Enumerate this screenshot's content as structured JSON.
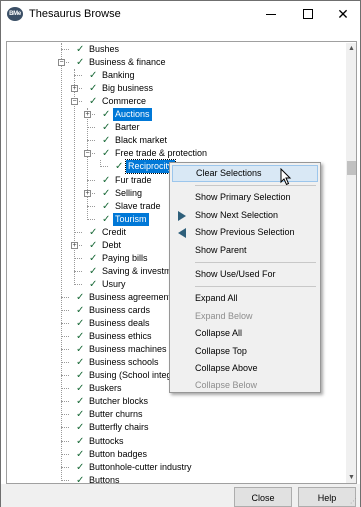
{
  "window": {
    "app_icon_text": "BMe",
    "title": "Thesaurus Browse",
    "minimize_glyph": "—",
    "maximize_glyph": "☐",
    "close_glyph": "✕"
  },
  "tree": {
    "items": [
      {
        "label": "Bushes",
        "level": 1,
        "checked": true,
        "expander": "",
        "selected": false
      },
      {
        "label": "Business & finance",
        "level": 1,
        "checked": true,
        "expander": "-",
        "selected": false
      },
      {
        "label": "Banking",
        "level": 2,
        "checked": true,
        "expander": "",
        "selected": false
      },
      {
        "label": "Big business",
        "level": 2,
        "checked": true,
        "expander": "+",
        "selected": false
      },
      {
        "label": "Commerce",
        "level": 2,
        "checked": true,
        "expander": "-",
        "selected": false
      },
      {
        "label": "Auctions",
        "level": 3,
        "checked": true,
        "expander": "+",
        "selected": true
      },
      {
        "label": "Barter",
        "level": 3,
        "checked": true,
        "expander": "",
        "selected": false
      },
      {
        "label": "Black market",
        "level": 3,
        "checked": true,
        "expander": "",
        "selected": false
      },
      {
        "label": "Free trade & protection",
        "level": 3,
        "checked": true,
        "expander": "-",
        "selected": false
      },
      {
        "label": "Reciprocity",
        "level": 4,
        "checked": true,
        "expander": "",
        "selected": true
      },
      {
        "label": "Fur trade",
        "level": 3,
        "checked": true,
        "expander": "",
        "selected": false
      },
      {
        "label": "Selling",
        "level": 3,
        "checked": true,
        "expander": "+",
        "selected": false
      },
      {
        "label": "Slave trade",
        "level": 3,
        "checked": true,
        "expander": "",
        "selected": false
      },
      {
        "label": "Tourism",
        "level": 3,
        "checked": true,
        "expander": "",
        "selected": true
      },
      {
        "label": "Credit",
        "level": 2,
        "checked": true,
        "expander": "",
        "selected": false
      },
      {
        "label": "Debt",
        "level": 2,
        "checked": true,
        "expander": "+",
        "selected": false
      },
      {
        "label": "Paying bills",
        "level": 2,
        "checked": true,
        "expander": "",
        "selected": false
      },
      {
        "label": "Saving & investme",
        "level": 2,
        "checked": true,
        "expander": "",
        "selected": false
      },
      {
        "label": "Usury",
        "level": 2,
        "checked": true,
        "expander": "",
        "selected": false
      },
      {
        "label": "Business agreements",
        "level": 1,
        "checked": true,
        "expander": "",
        "selected": false
      },
      {
        "label": "Business cards",
        "level": 1,
        "checked": true,
        "expander": "",
        "selected": false
      },
      {
        "label": "Business deals",
        "level": 1,
        "checked": true,
        "expander": "",
        "selected": false
      },
      {
        "label": "Business ethics",
        "level": 1,
        "checked": true,
        "expander": "",
        "selected": false
      },
      {
        "label": "Business machines",
        "level": 1,
        "checked": true,
        "expander": "",
        "selected": false
      },
      {
        "label": "Business schools",
        "level": 1,
        "checked": true,
        "expander": "",
        "selected": false
      },
      {
        "label": "Busing (School integra",
        "level": 1,
        "checked": true,
        "expander": "",
        "selected": false
      },
      {
        "label": "Buskers",
        "level": 1,
        "checked": true,
        "expander": "",
        "selected": false
      },
      {
        "label": "Butcher blocks",
        "level": 1,
        "checked": true,
        "expander": "",
        "selected": false
      },
      {
        "label": "Butter churns",
        "level": 1,
        "checked": true,
        "expander": "",
        "selected": false
      },
      {
        "label": "Butterfly chairs",
        "level": 1,
        "checked": true,
        "expander": "",
        "selected": false
      },
      {
        "label": "Buttocks",
        "level": 1,
        "checked": true,
        "expander": "",
        "selected": false
      },
      {
        "label": "Button badges",
        "level": 1,
        "checked": true,
        "expander": "",
        "selected": false
      },
      {
        "label": "Buttonhole-cutter industry",
        "level": 1,
        "checked": true,
        "expander": "",
        "selected": false
      },
      {
        "label": "Buttons",
        "level": 1,
        "checked": true,
        "expander": "",
        "selected": false
      }
    ]
  },
  "context_menu": {
    "items": [
      {
        "label": "Clear Selections",
        "enabled": true,
        "hover": true,
        "arrow": ""
      },
      {
        "separator": true
      },
      {
        "label": "Show Primary Selection",
        "enabled": true,
        "hover": false,
        "arrow": ""
      },
      {
        "label": "Show Next Selection",
        "enabled": true,
        "hover": false,
        "arrow": "right"
      },
      {
        "label": "Show Previous Selection",
        "enabled": true,
        "hover": false,
        "arrow": "left"
      },
      {
        "label": "Show Parent",
        "enabled": true,
        "hover": false,
        "arrow": ""
      },
      {
        "separator": true
      },
      {
        "label": "Show Use/Used For",
        "enabled": true,
        "hover": false,
        "arrow": ""
      },
      {
        "separator": true
      },
      {
        "label": "Expand All",
        "enabled": true,
        "hover": false,
        "arrow": ""
      },
      {
        "label": "Expand Below",
        "enabled": false,
        "hover": false,
        "arrow": ""
      },
      {
        "label": "Collapse All",
        "enabled": true,
        "hover": false,
        "arrow": ""
      },
      {
        "label": "Collapse Top",
        "enabled": true,
        "hover": false,
        "arrow": ""
      },
      {
        "label": "Collapse Above",
        "enabled": true,
        "hover": false,
        "arrow": ""
      },
      {
        "label": "Collapse Below",
        "enabled": false,
        "hover": false,
        "arrow": ""
      }
    ]
  },
  "footer": {
    "close_label": "Close",
    "help_label": "Help"
  },
  "colors": {
    "selection": "#0078d7",
    "checkmark": "#1c6b3a",
    "menu_hover": "#d9e8f5",
    "arrow": "#2e5f7a"
  },
  "icons": {
    "check": "✓",
    "expand": "+",
    "collapse": "−",
    "scroll_up": "▲",
    "scroll_down": "▼"
  }
}
